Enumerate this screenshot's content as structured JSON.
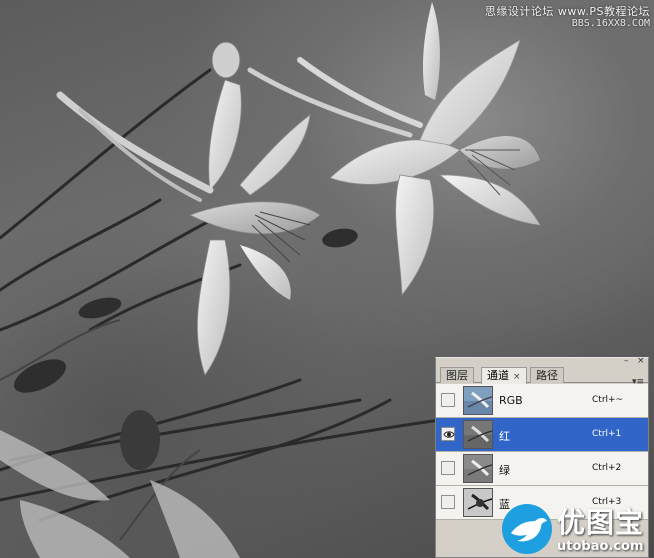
{
  "watermark": {
    "line1": "思缘设计论坛 www.PS教程论坛",
    "line2": "BBS.16XX8.COM"
  },
  "channels_panel": {
    "tabs": [
      {
        "label": "图层",
        "active": false
      },
      {
        "label": "通道",
        "active": true,
        "close": "×"
      },
      {
        "label": "路径",
        "active": false
      }
    ],
    "minimize_glyph": "–",
    "close_glyph": "×",
    "menu_glyph": "▾≡",
    "rows": [
      {
        "name": "RGB",
        "shortcut": "Ctrl+~",
        "visible": false,
        "selected": false
      },
      {
        "name": "红",
        "shortcut": "Ctrl+1",
        "visible": true,
        "selected": true
      },
      {
        "name": "绿",
        "shortcut": "Ctrl+2",
        "visible": false,
        "selected": false
      },
      {
        "name": "蓝",
        "shortcut": "Ctrl+3",
        "visible": false,
        "selected": false
      }
    ]
  },
  "logo": {
    "brand": "优图宝",
    "url": "utobao.com",
    "color": "#1e9fe0"
  },
  "colors": {
    "selection": "#3166c8",
    "panel_bg": "#d4d0c8"
  }
}
